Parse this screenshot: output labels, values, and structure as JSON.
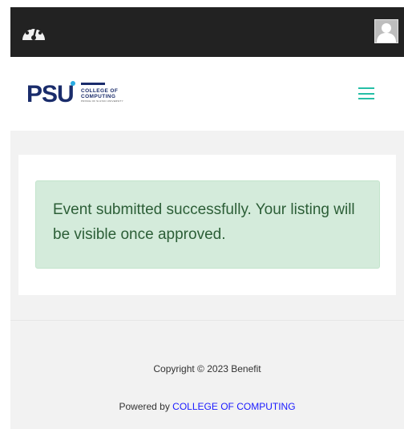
{
  "topbar": {
    "dashboard_icon": "tachometer-icon",
    "avatar_icon": "user-avatar-icon"
  },
  "navbar": {
    "logo": {
      "brand": "PSU",
      "line1": "COLLEGE OF",
      "line2": "COMPUTING",
      "tagline": "PRINCE OF SULTAN UNIVERSITY"
    },
    "menu_icon": "hamburger-menu-icon"
  },
  "alert": {
    "message": "Event submitted successfully. Your listing will be visible once approved."
  },
  "footer": {
    "copyright": "Copyright © 2023 Benefit",
    "powered_prefix": "Powered by ",
    "powered_link": "COLLEGE OF COMPUTING"
  },
  "colors": {
    "topbar": "#222222",
    "accent": "#26bfa6",
    "alert_bg": "#d4ebdb",
    "alert_text": "#2c5e37",
    "link": "#1a1aff",
    "brand_navy": "#1a2c6b",
    "brand_cyan": "#29abe2"
  }
}
